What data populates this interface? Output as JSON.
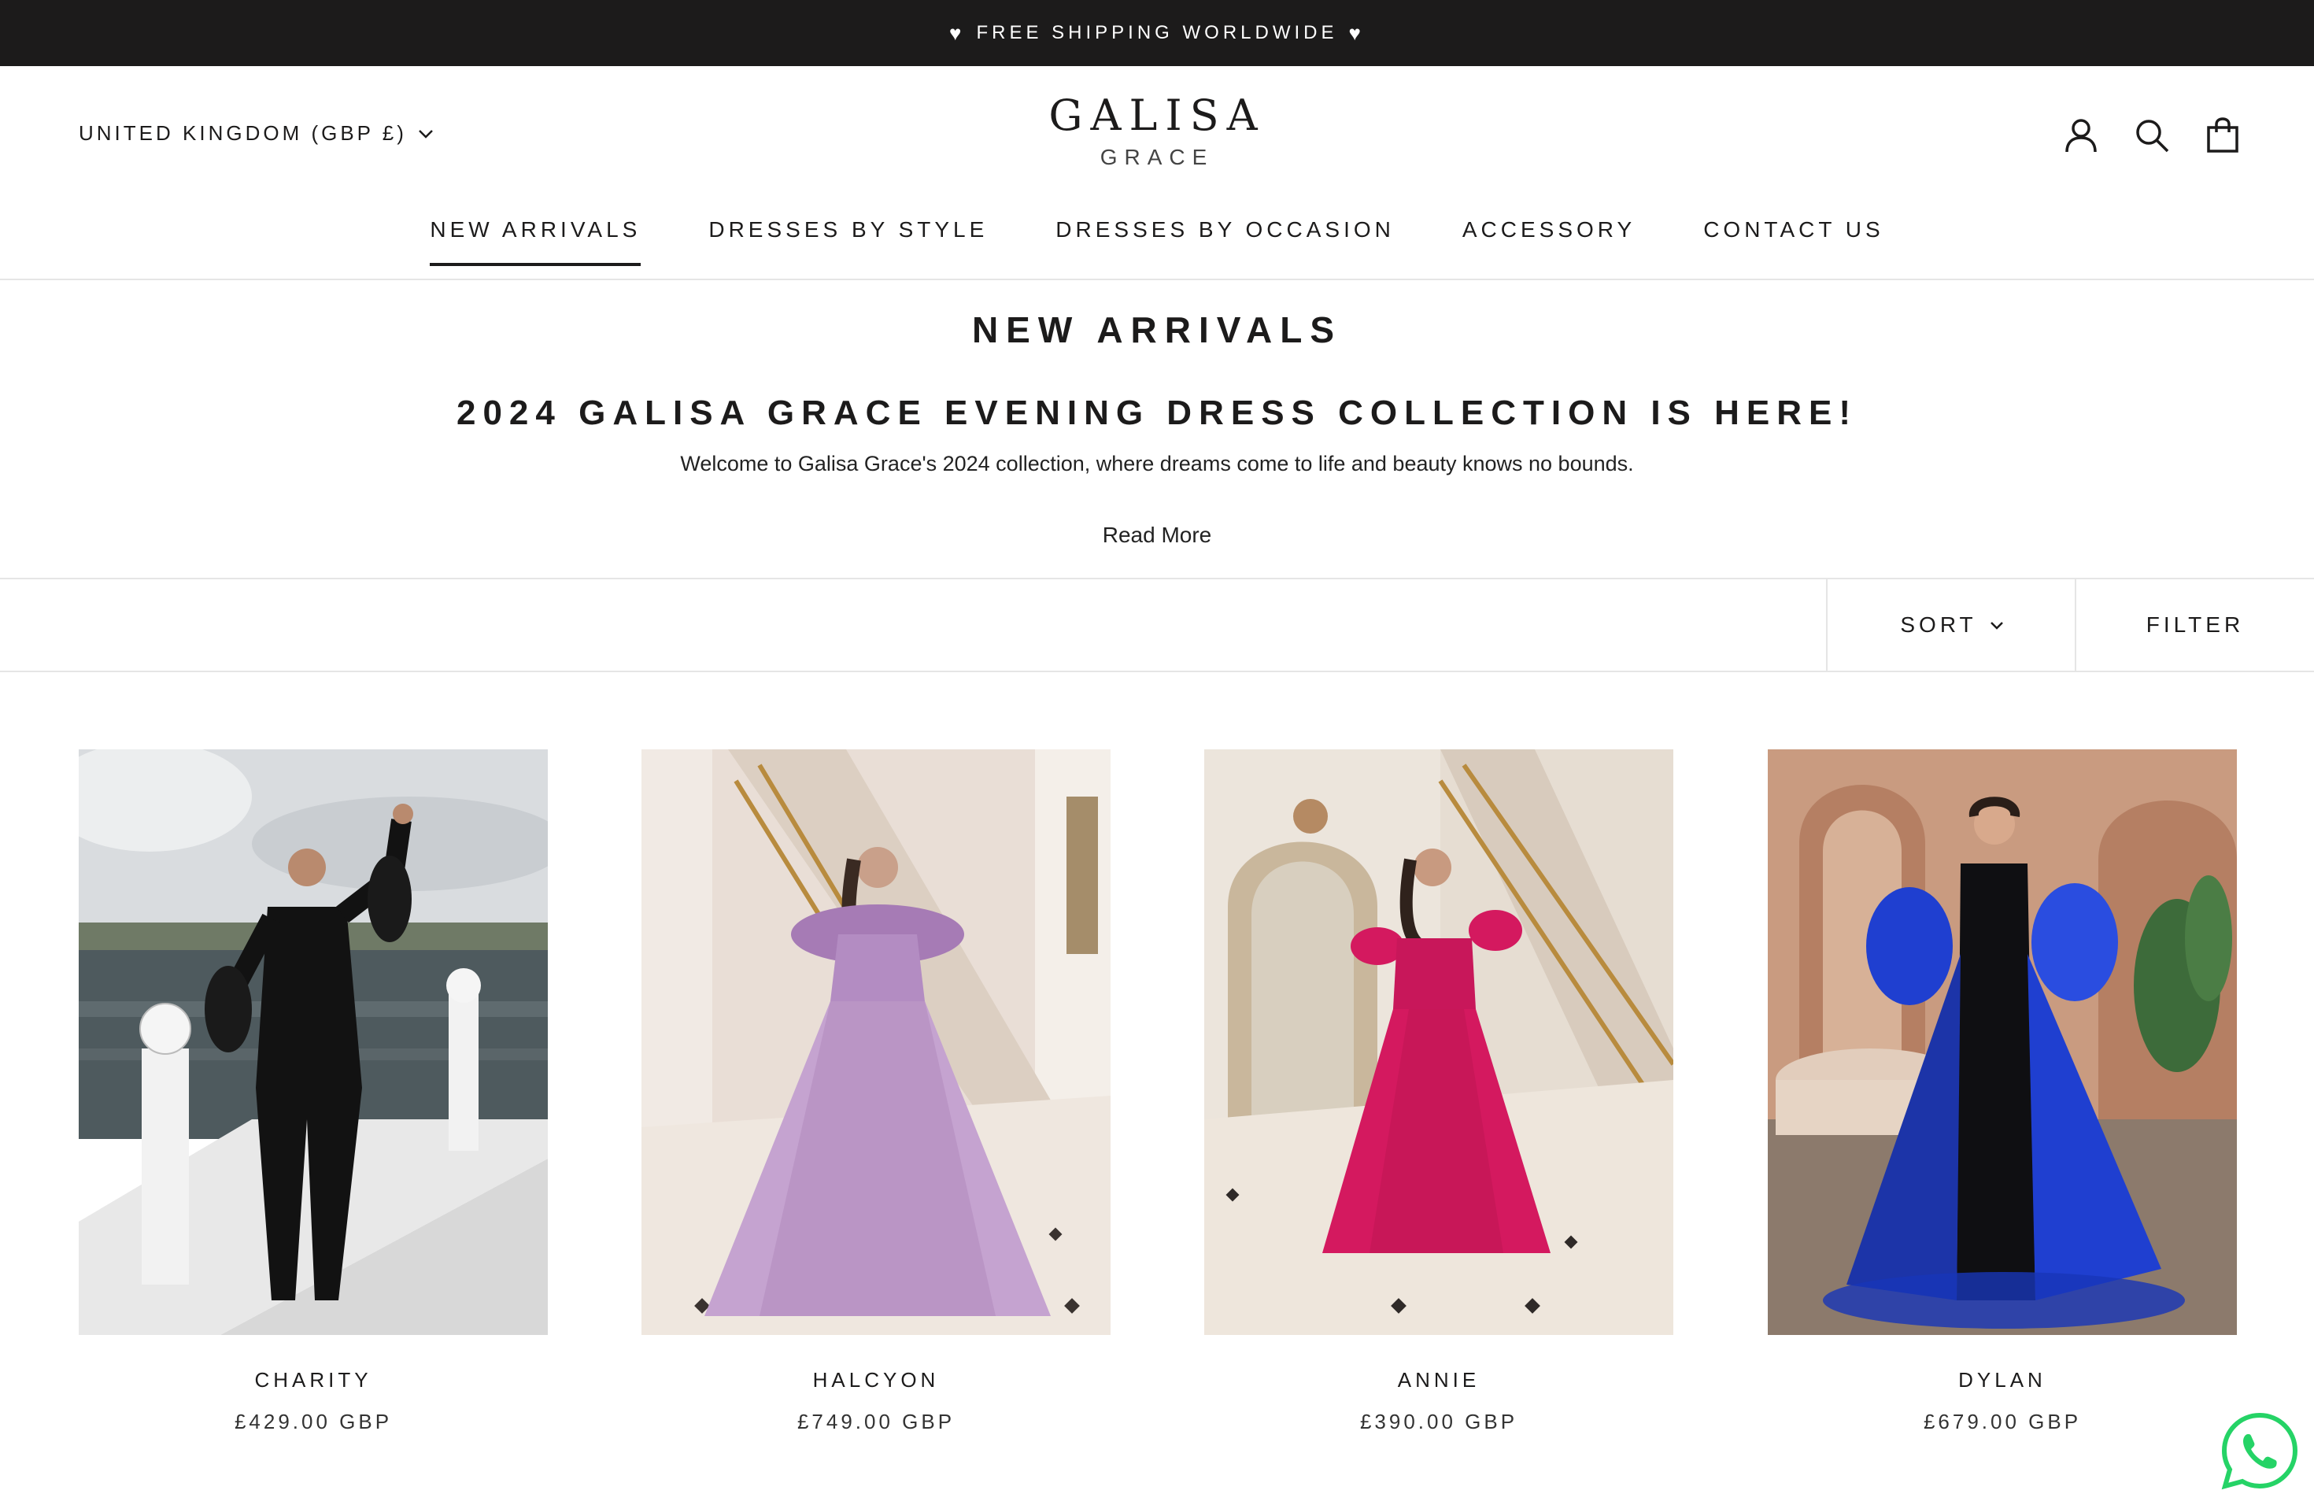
{
  "announcement": {
    "heart_left": "♥",
    "text": "FREE SHIPPING WORLDWIDE",
    "heart_right": "♥"
  },
  "header": {
    "locale": "UNITED KINGDOM (GBP £)",
    "logo_line1": "GALISA",
    "logo_line2": "GRACE",
    "icons": [
      "account-icon",
      "search-icon",
      "cart-icon"
    ]
  },
  "nav": {
    "items": [
      {
        "label": "NEW ARRIVALS",
        "active": true
      },
      {
        "label": "DRESSES BY STYLE",
        "active": false
      },
      {
        "label": "DRESSES BY OCCASION",
        "active": false
      },
      {
        "label": "ACCESSORY",
        "active": false
      },
      {
        "label": "CONTACT US",
        "active": false
      }
    ]
  },
  "collection": {
    "title": "NEW ARRIVALS",
    "headline": "2024 GALISA GRACE EVENING DRESS COLLECTION IS HERE!",
    "intro": "Welcome to Galisa Grace's 2024 collection, where dreams come to life and beauty knows no bounds.",
    "read_more": "Read More"
  },
  "toolbar": {
    "sort_label": "SORT",
    "filter_label": "FILTER"
  },
  "products": [
    {
      "name": "CHARITY",
      "price": "£429.00 GBP",
      "dress_color": "#121212"
    },
    {
      "name": "HALCYON",
      "price": "£749.00 GBP",
      "dress_color": "#b58fc0"
    },
    {
      "name": "ANNIE",
      "price": "£390.00 GBP",
      "dress_color": "#d4195f"
    },
    {
      "name": "DYLAN",
      "price": "£679.00 GBP",
      "dress_color": "#1f3fd0"
    }
  ],
  "colors": {
    "announcement_bg": "#1c1b1b",
    "text": "#1c1b1b",
    "divider": "#e5e5e5",
    "whatsapp": "#25d366"
  }
}
